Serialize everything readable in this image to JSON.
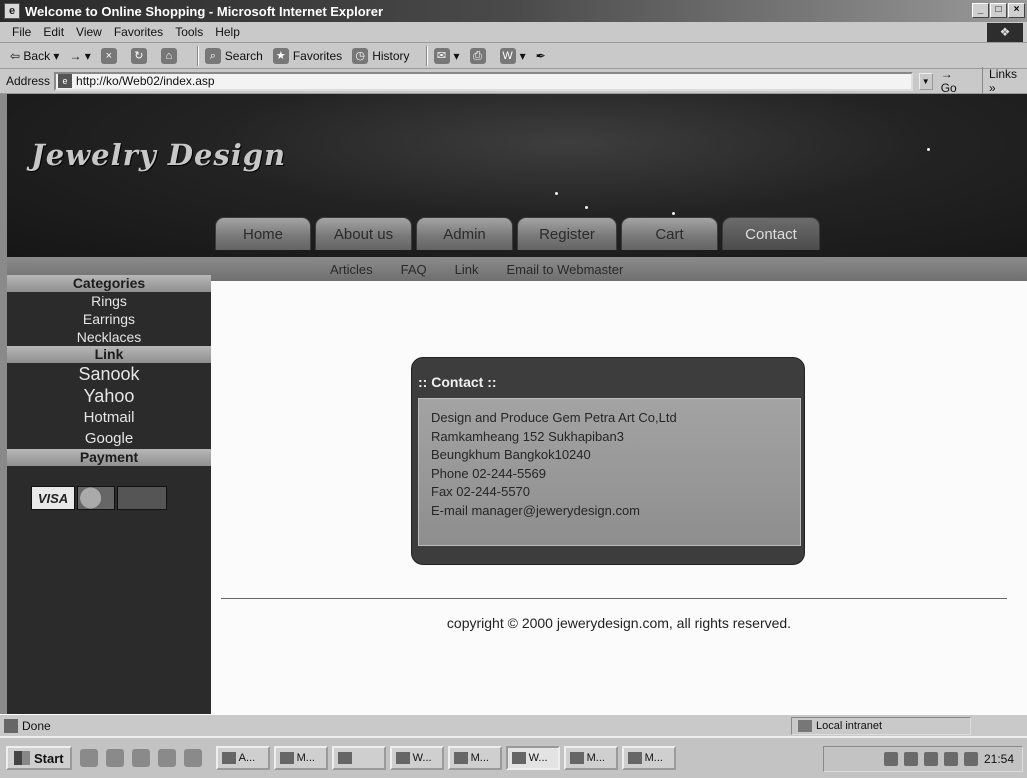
{
  "window": {
    "title": "Welcome to Online Shopping - Microsoft Internet Explorer",
    "controls": [
      "_",
      "□",
      "×"
    ]
  },
  "menu": [
    "File",
    "Edit",
    "View",
    "Favorites",
    "Tools",
    "Help"
  ],
  "toolbar": {
    "back": "Back",
    "search": "Search",
    "favorites": "Favorites",
    "history": "History"
  },
  "address": {
    "label": "Address",
    "url": "http://ko/Web02/index.asp",
    "go": "Go",
    "links": "Links »"
  },
  "site": {
    "logo": "Jewelry Design",
    "nav": [
      "Home",
      "About us",
      "Admin",
      "Register",
      "Cart",
      "Contact"
    ],
    "active_nav": "Contact",
    "subnav": [
      "Articles",
      "FAQ",
      "Link",
      "Email to Webmaster"
    ]
  },
  "sidebar": {
    "categories_heading": "Categories",
    "categories": [
      "Rings",
      "Earrings",
      "Necklaces"
    ],
    "link_heading": "Link",
    "links": [
      "Sanook",
      "Yahoo",
      "Hotmail",
      "Google"
    ],
    "payment_heading": "Payment",
    "cards": [
      "VISA",
      "MasterCard",
      "Amex"
    ]
  },
  "contact": {
    "heading": ":: Contact ::",
    "lines": [
      "Design and Produce Gem Petra Art Co,Ltd",
      "Ramkamheang 152 Sukhapiban3",
      "Beungkhum Bangkok10240",
      "Phone 02-244-5569",
      "Fax 02-244-5570",
      "E-mail   manager@jewerydesign.com"
    ]
  },
  "footer": {
    "copyright": "copyright © 2000 jewerydesign.com, all rights reserved."
  },
  "status": {
    "text": "Done",
    "zone": "Local intranet"
  },
  "taskbar": {
    "start": "Start",
    "tasks": [
      "A...",
      "M...",
      "",
      "W...",
      "M...",
      "W...",
      "M...",
      "M..."
    ],
    "clock": "21:54"
  }
}
